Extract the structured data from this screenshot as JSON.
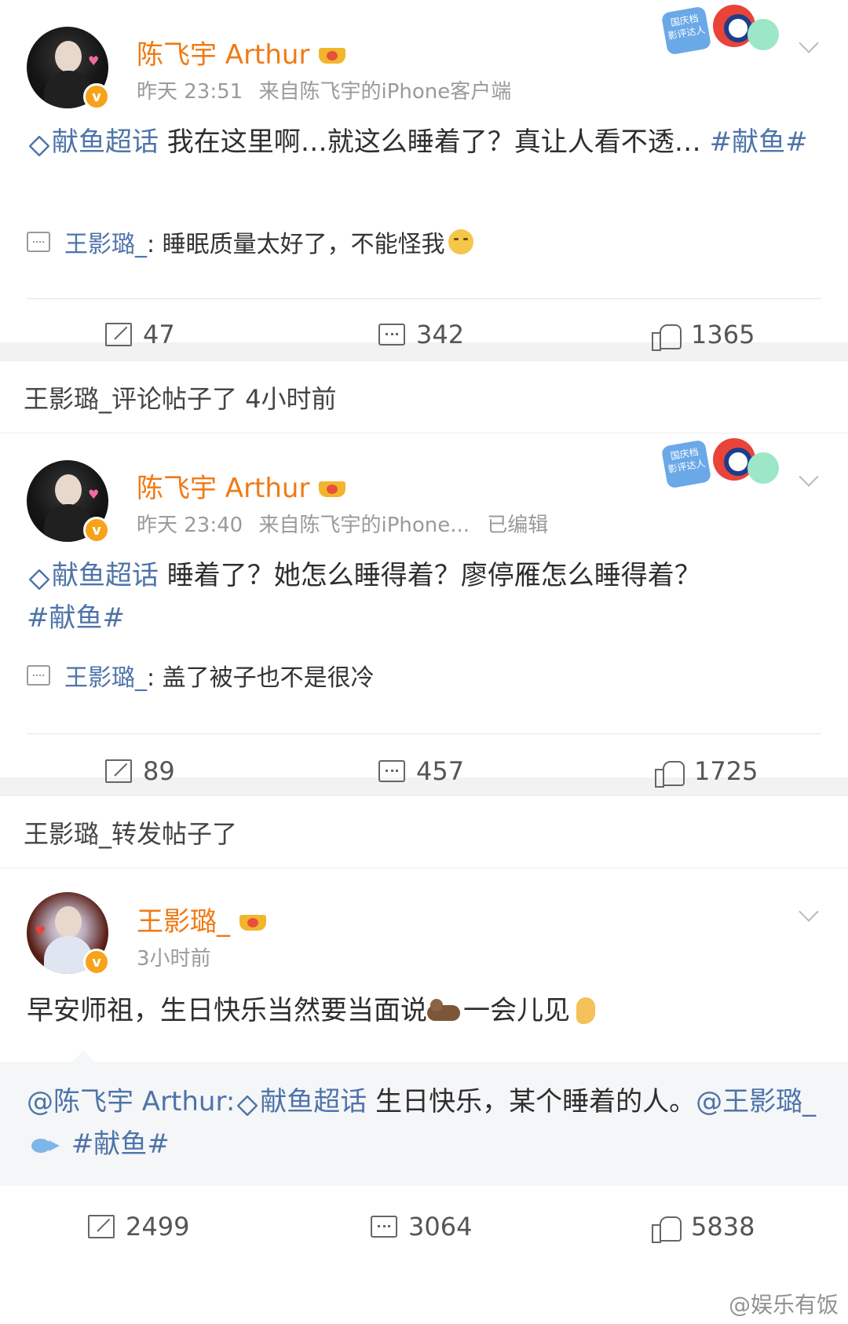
{
  "post1": {
    "username": "陈飞宇 Arthur",
    "time": "昨天 23:51",
    "source": "来自陈飞宇的iPhone客户端",
    "badge_text": "国庆档 影评达人",
    "topic": "献鱼超话",
    "text": " 我在这里啊…就这么睡着了？真让人看不透… ",
    "hashtag": "#献鱼#",
    "comment_user": "王影璐_",
    "comment_text": ": 睡眠质量太好了，不能怪我",
    "reposts": "47",
    "comments": "342",
    "likes": "1365"
  },
  "label1": "王影璐_评论帖子了 4小时前",
  "post2": {
    "username": "陈飞宇 Arthur",
    "time": "昨天 23:40",
    "source": "来自陈飞宇的iPhone...",
    "edited": "已编辑",
    "badge_text": "国庆档 影评达人",
    "topic": "献鱼超话",
    "text": " 睡着了？她怎么睡得着？廖停雁怎么睡得着？",
    "hashtag": "#献鱼#",
    "comment_user": "王影璐_",
    "comment_text": ": 盖了被子也不是很冷",
    "reposts": "89",
    "comments": "457",
    "likes": "1725"
  },
  "label2": "王影璐_转发帖子了",
  "post3": {
    "username": "王影璐_",
    "time": "3小时前",
    "text_a": "早安师祖，生日快乐当然要当面说",
    "text_b": "一会儿见",
    "repost_user": "@陈飞宇 Arthur:",
    "repost_topic": "献鱼超话",
    "repost_text": " 生日快乐，某个睡着的人。",
    "repost_mention": "@王影璐_",
    "repost_hashtag": "#献鱼#",
    "reposts": "2499",
    "comments": "3064",
    "likes": "5838"
  },
  "watermark": "@娱乐有饭",
  "colors": {
    "username": "#f07a14",
    "link": "#4e74a8",
    "meta": "#9a9a9a",
    "gap": "#f2f2f2",
    "repost_bg": "#f5f6f8"
  },
  "icons": [
    "chevron-down-icon",
    "gem-icon",
    "comment-icon",
    "repost-icon",
    "like-icon",
    "crown-icon",
    "verified-icon"
  ]
}
